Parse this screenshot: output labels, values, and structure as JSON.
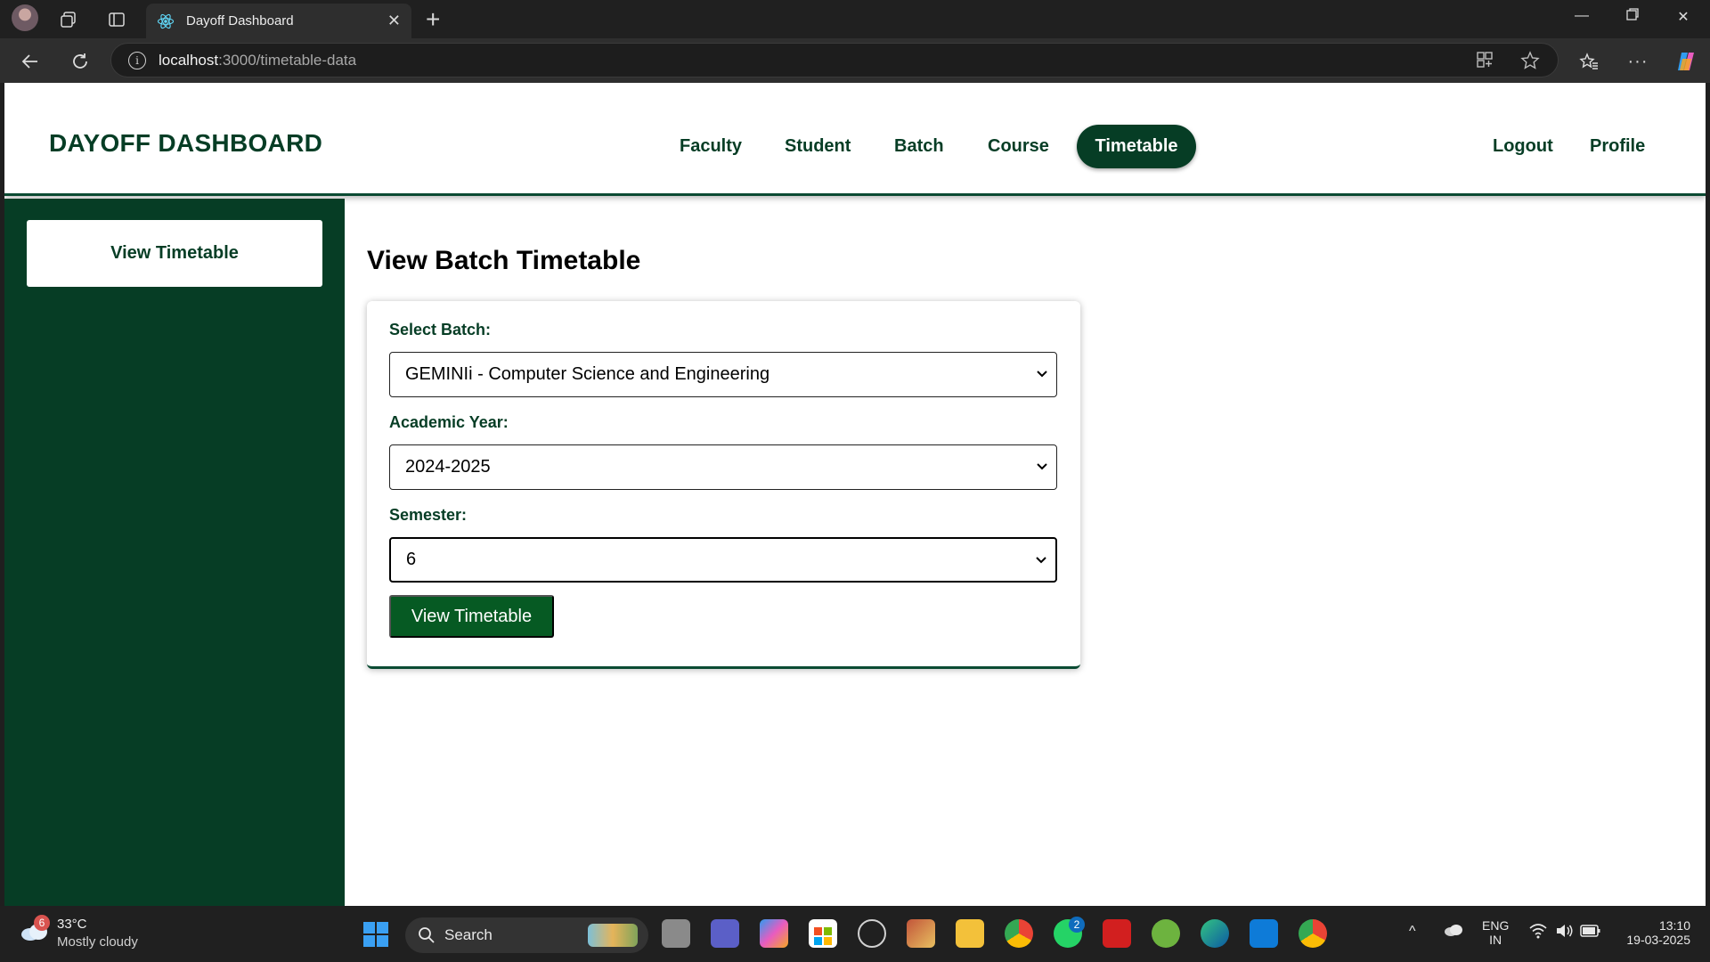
{
  "browser": {
    "tab_title": "Dayoff Dashboard",
    "url_host": "localhost",
    "url_path": ":3000/timetable-data"
  },
  "header": {
    "brand": "DAYOFF DASHBOARD",
    "nav": [
      "Faculty",
      "Student",
      "Batch",
      "Course",
      "Timetable"
    ],
    "active_nav": "Timetable",
    "right_links": [
      "Logout",
      "Profile"
    ]
  },
  "sidebar": {
    "items": [
      "View Timetable"
    ]
  },
  "main": {
    "title": "View Batch Timetable",
    "form": {
      "batch_label": "Select Batch:",
      "batch_value": "GEMINIi - Computer Science and Engineering",
      "year_label": "Academic Year:",
      "year_value": "2024-2025",
      "semester_label": "Semester:",
      "semester_value": "6",
      "submit_label": "View Timetable"
    }
  },
  "taskbar": {
    "weather_badge": "6",
    "temperature": "33°C",
    "weather": "Mostly cloudy",
    "search_label": "Search",
    "whatsapp_badge": "2",
    "lang_top": "ENG",
    "lang_bottom": "IN",
    "time": "13:10",
    "date": "19-03-2025"
  },
  "colors": {
    "brand_green": "#063d25",
    "button_green": "#065a23"
  }
}
